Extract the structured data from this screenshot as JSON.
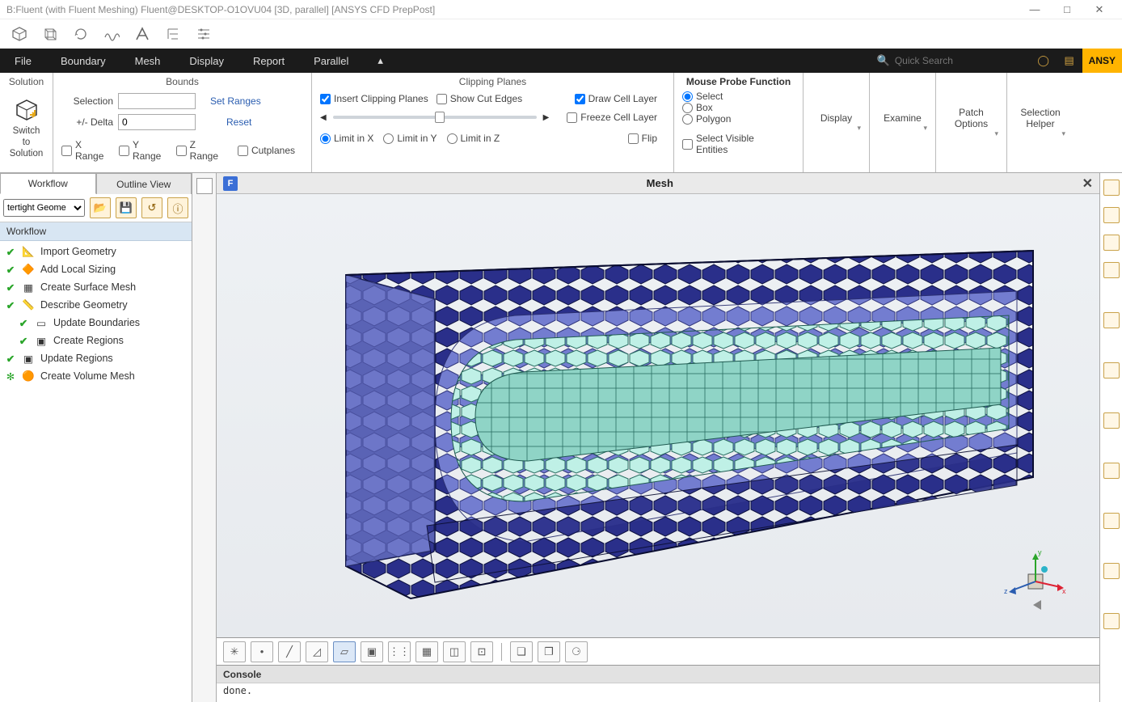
{
  "title": "B:Fluent (with Fluent Meshing) Fluent@DESKTOP-O1OVU04  [3D, parallel] [ANSYS CFD PrepPost]",
  "menu": {
    "items": [
      "File",
      "Boundary",
      "Mesh",
      "Display",
      "Report",
      "Parallel"
    ],
    "search_placeholder": "Quick Search",
    "logo": "ANSY"
  },
  "ribbon": {
    "solution": {
      "title": "Solution",
      "btn": "Switch to Solution"
    },
    "bounds": {
      "title": "Bounds",
      "selection_label": "Selection",
      "set_ranges": "Set Ranges",
      "delta_label": "+/- Delta",
      "delta_value": "0",
      "reset": "Reset",
      "xrange": "X Range",
      "yrange": "Y Range",
      "zrange": "Z Range",
      "cutplanes": "Cutplanes"
    },
    "clip": {
      "title": "Clipping Planes",
      "insert": "Insert Clipping Planes",
      "showcut": "Show Cut Edges",
      "drawcell": "Draw Cell Layer",
      "freeze": "Freeze Cell Layer",
      "limx": "Limit in X",
      "limy": "Limit in Y",
      "limz": "Limit in Z",
      "flip": "Flip"
    },
    "mouse": {
      "title": "Mouse Probe Function",
      "select": "Select",
      "box": "Box",
      "polygon": "Polygon",
      "visible": "Select Visible Entities"
    },
    "cols": {
      "display": "Display",
      "examine": "Examine",
      "patch": "Patch Options",
      "selhelper": "Selection Helper"
    }
  },
  "left": {
    "tabs": {
      "workflow": "Workflow",
      "outline": "Outline View"
    },
    "dd_value": "tertight Geome",
    "header": "Workflow",
    "nodes": {
      "import": "Import Geometry",
      "local": "Add Local Sizing",
      "surf": "Create Surface Mesh",
      "desc": "Describe Geometry",
      "updb": "Update Boundaries",
      "creg": "Create Regions",
      "updr": "Update Regions",
      "vol": "Create Volume Mesh"
    }
  },
  "viewport": {
    "title": "Mesh",
    "badge": "F"
  },
  "console": {
    "header": "Console",
    "line": "done."
  },
  "triad": {
    "x": "x",
    "y": "y",
    "z": "z"
  }
}
